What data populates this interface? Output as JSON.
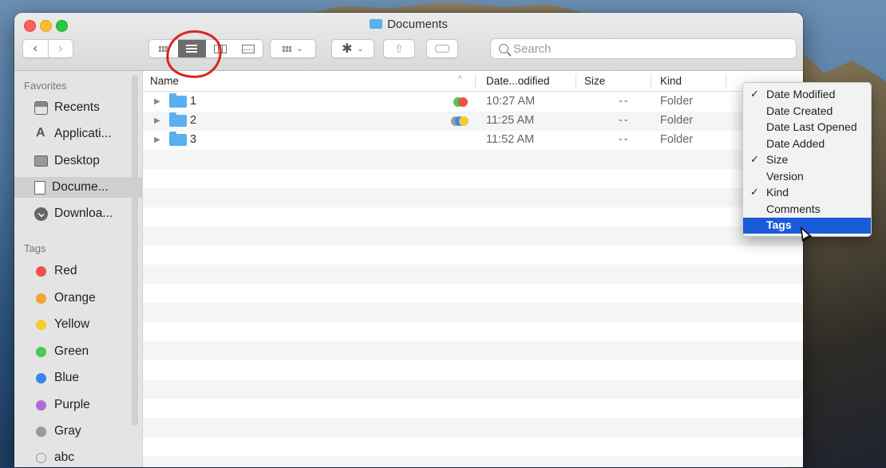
{
  "window": {
    "title": "Documents",
    "folder_icon": "documents-folder-icon"
  },
  "toolbar": {
    "nav_back": "‹",
    "nav_forward": "›",
    "view_modes": [
      "icon-view",
      "list-view",
      "column-view",
      "gallery-view"
    ],
    "active_view": "list-view",
    "group_icon": "group-grid-icon",
    "action_icon": "gear-icon",
    "share_icon": "share-icon",
    "tag_icon": "tag-icon",
    "search_placeholder": "Search"
  },
  "sidebar": {
    "favorites_header": "Favorites",
    "favorites": [
      {
        "label": "Recents",
        "icon": "recents-icon"
      },
      {
        "label": "Applicati...",
        "icon": "applications-icon"
      },
      {
        "label": "Desktop",
        "icon": "desktop-icon"
      },
      {
        "label": "Docume...",
        "icon": "documents-icon",
        "selected": true
      },
      {
        "label": "Downloa...",
        "icon": "downloads-icon"
      }
    ],
    "tags_header": "Tags",
    "tags": [
      {
        "label": "Red",
        "color": "#f05048"
      },
      {
        "label": "Orange",
        "color": "#f3a233"
      },
      {
        "label": "Yellow",
        "color": "#f5cd32"
      },
      {
        "label": "Green",
        "color": "#4ec652"
      },
      {
        "label": "Blue",
        "color": "#3b82f0"
      },
      {
        "label": "Purple",
        "color": "#b36ad8"
      },
      {
        "label": "Gray",
        "color": "#9a9a9a"
      },
      {
        "label": "abc",
        "color": ""
      }
    ]
  },
  "columns": {
    "name": "Name",
    "date": "Date...odified",
    "size": "Size",
    "kind": "Kind"
  },
  "rows": [
    {
      "name": "1",
      "date": "10:27 AM",
      "size": "--",
      "kind": "Folder",
      "tags": [
        "#f05048",
        "#4ec652"
      ]
    },
    {
      "name": "2",
      "date": "11:25 AM",
      "size": "--",
      "kind": "Folder",
      "tags": [
        "#9a9a9a",
        "#3b82f0",
        "#f5cd32"
      ]
    },
    {
      "name": "3",
      "date": "11:52 AM",
      "size": "--",
      "kind": "Folder",
      "tags": []
    }
  ],
  "column_menu": [
    {
      "label": "Date Modified",
      "checked": true
    },
    {
      "label": "Date Created",
      "checked": false
    },
    {
      "label": "Date Last Opened",
      "checked": false
    },
    {
      "label": "Date Added",
      "checked": false
    },
    {
      "label": "Size",
      "checked": true
    },
    {
      "label": "Version",
      "checked": false
    },
    {
      "label": "Kind",
      "checked": true
    },
    {
      "label": "Comments",
      "checked": false
    },
    {
      "label": "Tags",
      "checked": false,
      "highlighted": true
    }
  ],
  "check_mark": "✓",
  "colors": {
    "accent": "#1a5cd8",
    "annotation": "#d8241f",
    "folder": "#5ab0ee"
  }
}
